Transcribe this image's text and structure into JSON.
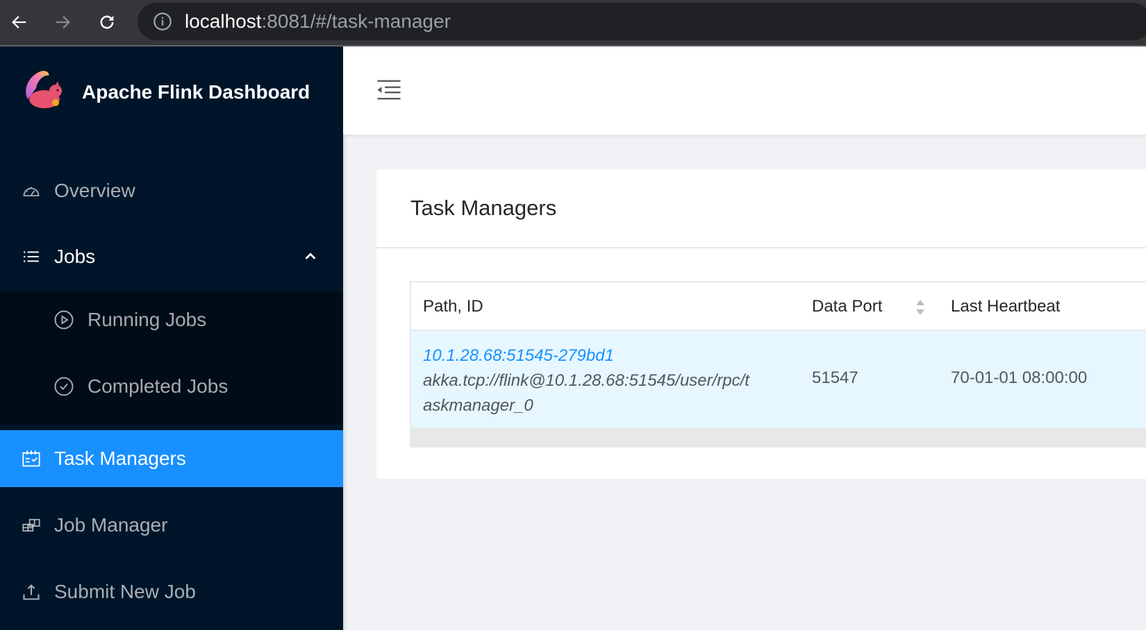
{
  "browser": {
    "url_host": "localhost",
    "url_path": ":8081/#/task-manager"
  },
  "sidebar": {
    "brand": "Apache Flink Dashboard",
    "items": [
      {
        "label": "Overview",
        "icon": "dashboard-icon"
      },
      {
        "label": "Jobs",
        "icon": "list-icon",
        "expanded": true
      },
      {
        "label": "Running Jobs",
        "icon": "play-circle-icon"
      },
      {
        "label": "Completed Jobs",
        "icon": "check-circle-icon"
      },
      {
        "label": "Task Managers",
        "icon": "schedule-icon",
        "active": true
      },
      {
        "label": "Job Manager",
        "icon": "build-icon"
      },
      {
        "label": "Submit New Job",
        "icon": "upload-icon"
      }
    ]
  },
  "main": {
    "card_title": "Task Managers",
    "table": {
      "columns": [
        "Path, ID",
        "Data Port",
        "Last Heartbeat"
      ],
      "rows": [
        {
          "id": "10.1.28.68:51545-279bd1",
          "path_line1": "akka.tcp://flink@10.1.28.68:51545/user/rpc/t",
          "path_line2": "askmanager_0",
          "data_port": "51547",
          "last_heartbeat": "70-01-01 08:00:00"
        }
      ]
    }
  },
  "colors": {
    "sidebar_bg": "#001529",
    "submenu_bg": "#000c17",
    "accent": "#1890ff",
    "row_highlight": "#e6f7ff"
  }
}
